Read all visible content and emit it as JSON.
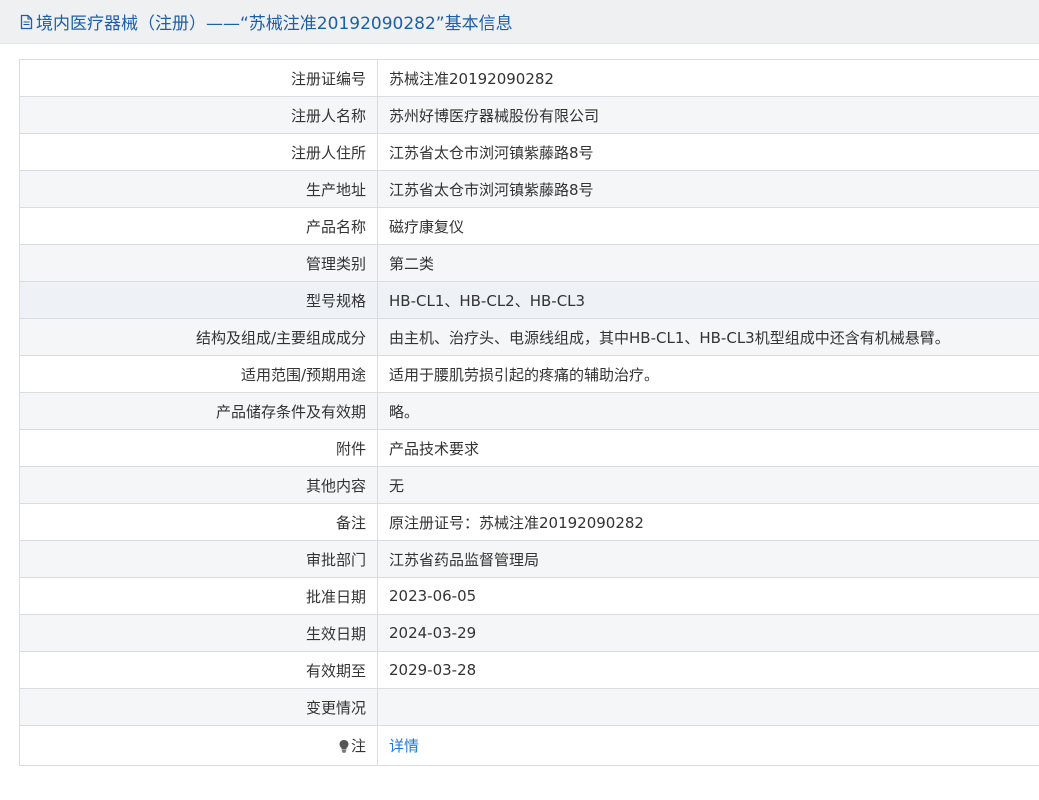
{
  "header": {
    "title": "境内医疗器械（注册）——“苏械注准20192090282”基本信息",
    "icon": "document-icon"
  },
  "rows": [
    {
      "label": "注册证编号",
      "value": "苏械注准20192090282"
    },
    {
      "label": "注册人名称",
      "value": "苏州好博医疗器械股份有限公司"
    },
    {
      "label": "注册人住所",
      "value": "江苏省太仓市浏河镇紫藤路8号"
    },
    {
      "label": "生产地址",
      "value": "江苏省太仓市浏河镇紫藤路8号"
    },
    {
      "label": "产品名称",
      "value": "磁疗康复仪"
    },
    {
      "label": "管理类别",
      "value": "第二类"
    },
    {
      "label": "型号规格",
      "value": "HB-CL1、HB-CL2、HB-CL3"
    },
    {
      "label": "结构及组成/主要组成成分",
      "value": "由主机、治疗头、电源线组成，其中HB-CL1、HB-CL3机型组成中还含有机械悬臂。"
    },
    {
      "label": "适用范围/预期用途",
      "value": "适用于腰肌劳损引起的疼痛的辅助治疗。"
    },
    {
      "label": "产品储存条件及有效期",
      "value": "略。"
    },
    {
      "label": "附件",
      "value": "产品技术要求"
    },
    {
      "label": "其他内容",
      "value": "无"
    },
    {
      "label": "备注",
      "value": "原注册证号：苏械注准20192090282"
    },
    {
      "label": "审批部门",
      "value": "江苏省药品监督管理局"
    },
    {
      "label": "批准日期",
      "value": "2023-06-05"
    },
    {
      "label": "生效日期",
      "value": "2024-03-29"
    },
    {
      "label": "有效期至",
      "value": "2029-03-28"
    },
    {
      "label": "变更情况",
      "value": ""
    }
  ],
  "note": {
    "label": "注",
    "icon": "lightbulb-icon",
    "link_text": "详情"
  },
  "colors": {
    "accent": "#1c5fa8",
    "link": "#1c7ad6",
    "border": "#d9dde1",
    "row_alt": "#f5f6f7"
  }
}
